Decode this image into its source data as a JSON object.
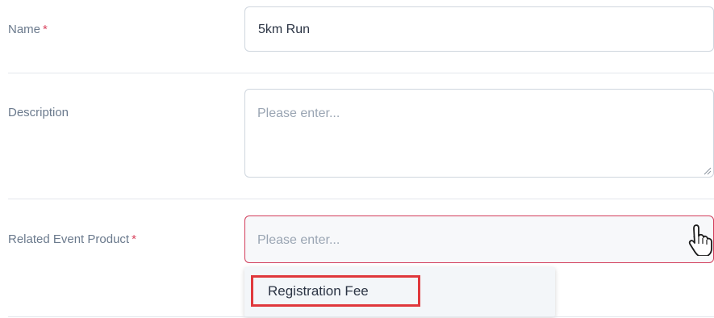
{
  "form": {
    "name": {
      "label": "Name",
      "required_mark": "*",
      "value": "5km Run"
    },
    "description": {
      "label": "Description",
      "placeholder": "Please enter..."
    },
    "related_event_product": {
      "label": "Related Event Product",
      "required_mark": "*",
      "placeholder": "Please enter...",
      "options": [
        "Registration Fee"
      ]
    }
  },
  "colors": {
    "required": "#d9455f",
    "error_border": "#d23d5b",
    "highlight_box": "#e0383c"
  },
  "icons": {
    "dropdown_caret": "chevron-down-icon",
    "cursor": "hand-pointer-icon",
    "resize": "resize-grip-icon"
  }
}
